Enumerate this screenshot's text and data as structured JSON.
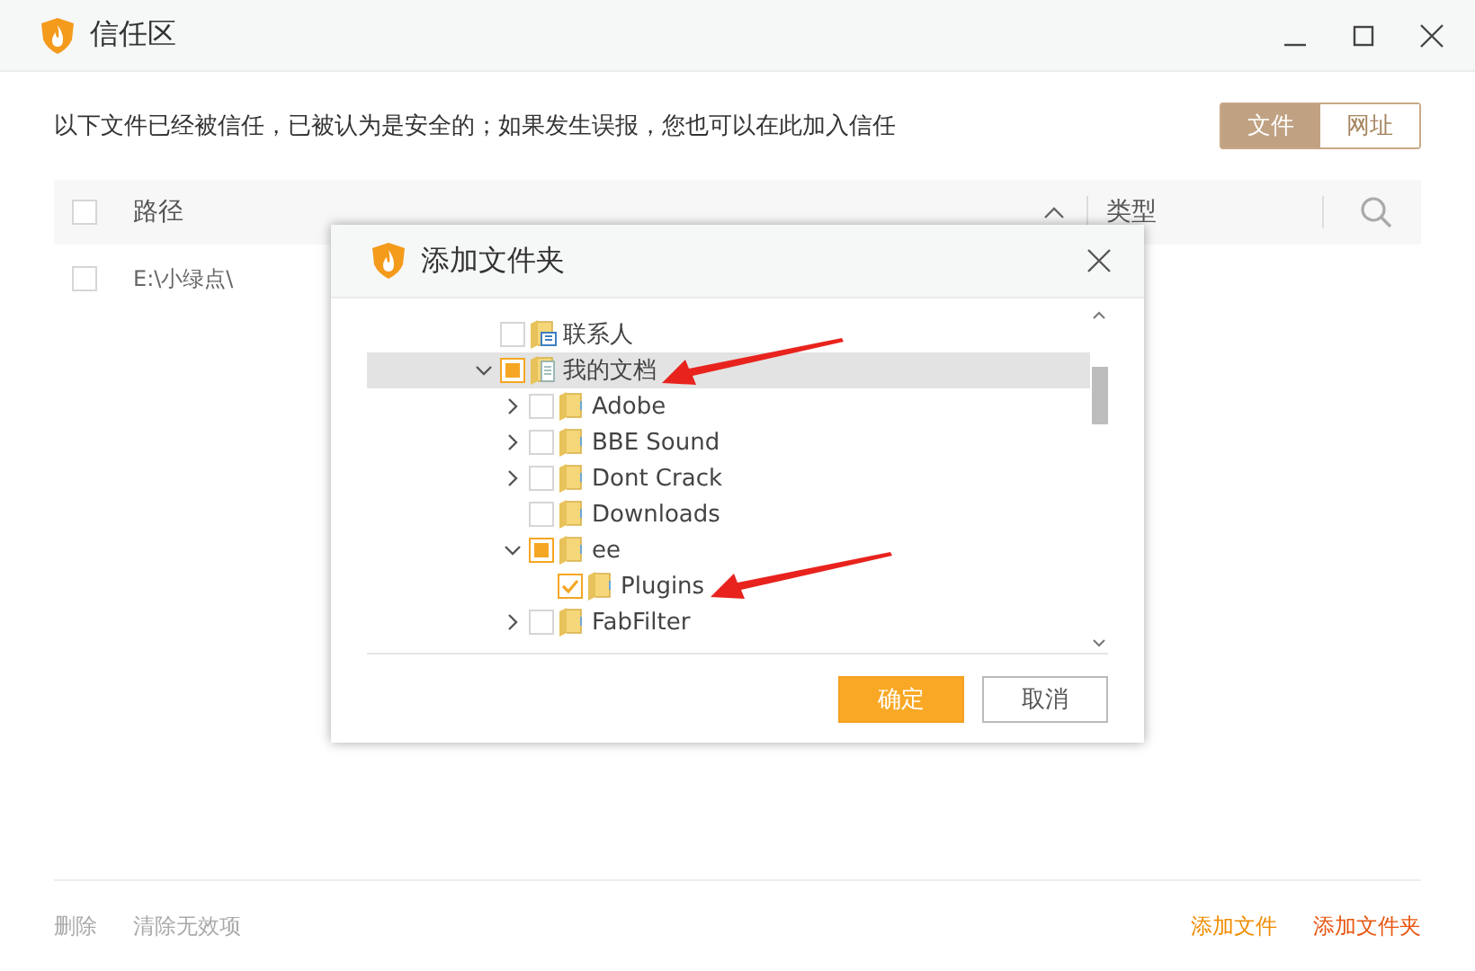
{
  "window": {
    "title": "信任区"
  },
  "description": "以下文件已经被信任，已被认为是安全的；如果发生误报，您也可以在此加入信任",
  "tabs": [
    {
      "label": "文件",
      "selected": true
    },
    {
      "label": "网址",
      "selected": false
    }
  ],
  "table": {
    "columns": [
      "路径",
      "类型"
    ],
    "select_all_checked": false,
    "rows": [
      {
        "path": "E:\\小绿点\\",
        "checked": false
      }
    ]
  },
  "footer": {
    "left_actions": [
      {
        "label": "删除",
        "disabled": true
      },
      {
        "label": "清除无效项",
        "disabled": true
      }
    ],
    "right_actions": [
      {
        "label": "添加文件",
        "color": "#f08c00"
      },
      {
        "label": "添加文件夹",
        "color": "#e8550f"
      }
    ]
  },
  "dialog": {
    "title": "添加文件夹",
    "tree": [
      {
        "label": "联系人",
        "kind": "contacts",
        "expandable": false,
        "checked": false,
        "partial": false,
        "selected": false,
        "pointed": false
      },
      {
        "label": "我的文档",
        "kind": "documents",
        "expandable": true,
        "expanded": true,
        "checked": false,
        "partial": true,
        "selected": true,
        "pointed": true,
        "children": [
          {
            "label": "Adobe",
            "kind": "folder",
            "expandable": true,
            "expanded": false,
            "checked": false,
            "partial": false,
            "selected": false,
            "pointed": false
          },
          {
            "label": "BBE Sound",
            "kind": "folder",
            "expandable": true,
            "expanded": false,
            "checked": false,
            "partial": false,
            "selected": false,
            "pointed": false
          },
          {
            "label": "Dont Crack",
            "kind": "folder",
            "expandable": true,
            "expanded": false,
            "checked": false,
            "partial": false,
            "selected": false,
            "pointed": false
          },
          {
            "label": "Downloads",
            "kind": "folder",
            "expandable": false,
            "checked": false,
            "partial": false,
            "selected": false,
            "pointed": false
          },
          {
            "label": "ee",
            "kind": "folder",
            "expandable": true,
            "expanded": true,
            "checked": false,
            "partial": true,
            "selected": false,
            "pointed": false,
            "children": [
              {
                "label": "Plugins",
                "kind": "folder",
                "expandable": false,
                "checked": true,
                "selected": false,
                "pointed": true
              }
            ]
          },
          {
            "label": "FabFilter",
            "kind": "folder",
            "expandable": true,
            "expanded": false,
            "checked": false,
            "partial": false,
            "selected": false,
            "pointed": false
          }
        ]
      }
    ],
    "buttons": [
      {
        "label": "确定",
        "kind": "primary"
      },
      {
        "label": "取消",
        "kind": "secondary"
      }
    ]
  }
}
